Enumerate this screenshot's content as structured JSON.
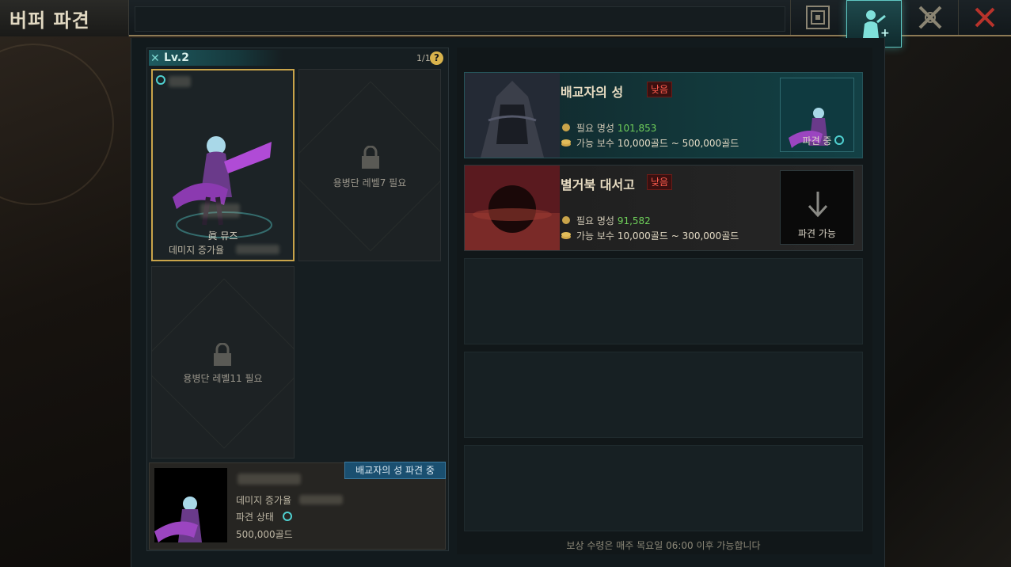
{
  "header": {
    "title": "버퍼 파견",
    "tabs": [
      {
        "icon": "map-grid-icon",
        "active": false
      },
      {
        "icon": "buffer-dispatch-icon",
        "active": true
      },
      {
        "icon": "crossed-swords-icon",
        "active": false
      },
      {
        "icon": "close-icon",
        "active": false
      }
    ]
  },
  "left": {
    "level": "Lv.2",
    "count": "1/1",
    "help": "?",
    "slots": [
      {
        "state": "active",
        "character_name": "眞 뮤즈",
        "stat_label": "데미지 증가율"
      },
      {
        "state": "locked",
        "requirement": "용병단 레벨7 필요"
      },
      {
        "state": "locked",
        "requirement": "용병단 레벨11 필요"
      }
    ],
    "info": {
      "status_tag": "배교자의 성 파견 중",
      "damage_label": "데미지 증가율",
      "status_label": "파견 상태",
      "gold": "500,000골드"
    }
  },
  "right": {
    "missions": [
      {
        "name": "배교자의 성",
        "difficulty": "낮음",
        "fame_label": "필요 명성",
        "fame_value": "101,853",
        "reward_label": "가능 보수",
        "reward_value": "10,000골드 ~ 500,000골드",
        "action": "파견 중"
      },
      {
        "name": "별거북 대서고",
        "difficulty": "낮음",
        "fame_label": "필요 명성",
        "fame_value": "91,582",
        "reward_label": "가능 보수",
        "reward_value": "10,000골드 ~ 300,000골드",
        "action": "파견 가능"
      }
    ],
    "footer": "보상 수령은 매주 목요일 06:00 이후 가능합니다"
  },
  "colors": {
    "accent_teal": "#5fc9c4",
    "gold_border": "#c9a44a",
    "difficulty_red": "#ff5b4d",
    "fame_green": "#6fcf5a"
  }
}
